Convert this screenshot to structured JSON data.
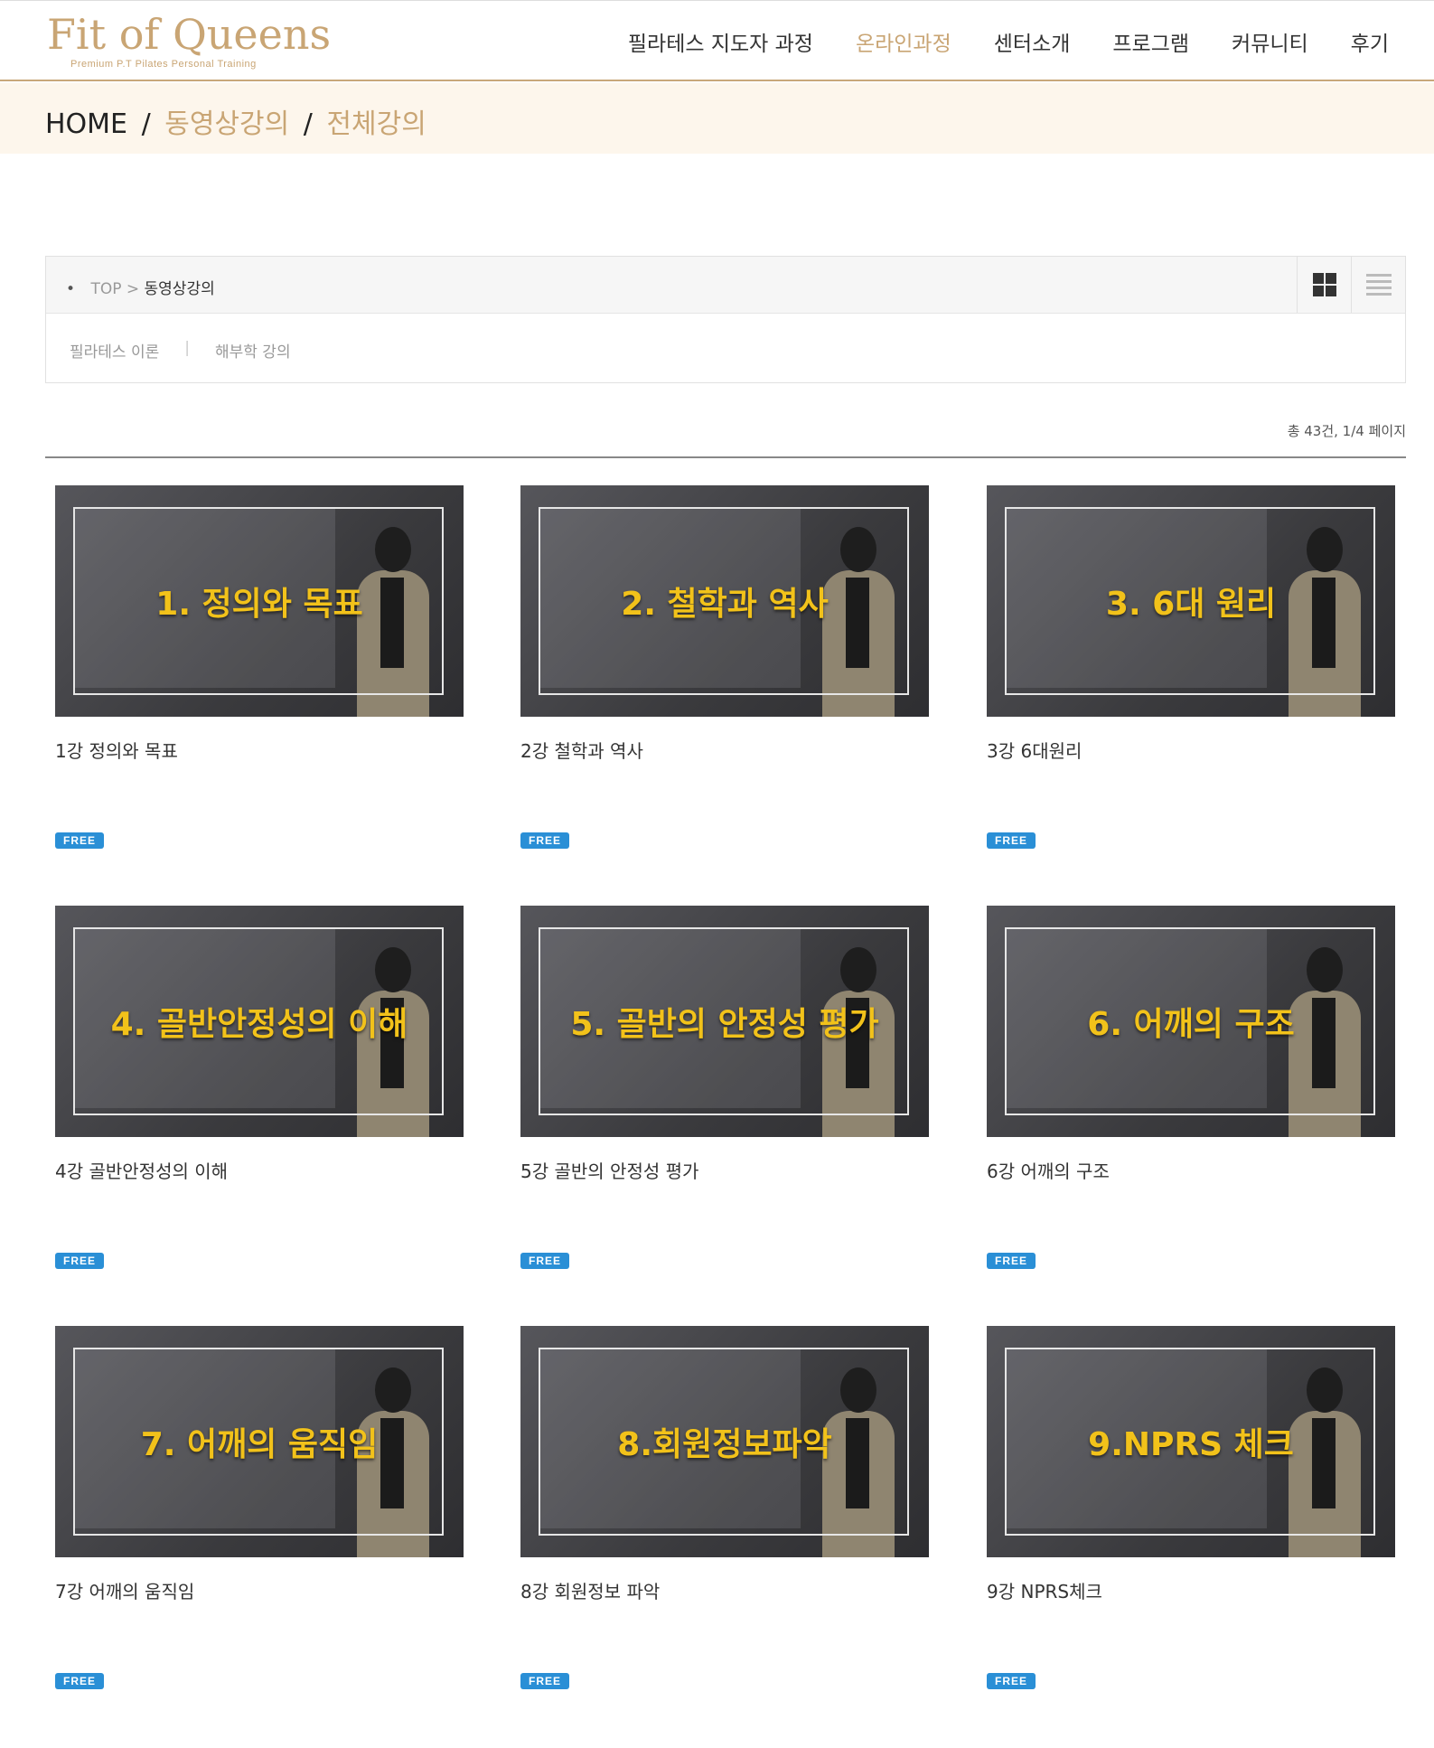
{
  "header": {
    "logo": "Fit of Queens",
    "logo_sub": "Premium P.T Pilates Personal Training",
    "nav": [
      {
        "label": "필라테스 지도자 과정"
      },
      {
        "label": "온라인과정"
      },
      {
        "label": "센터소개"
      },
      {
        "label": "프로그램"
      },
      {
        "label": "커뮤니티"
      },
      {
        "label": "후기"
      }
    ]
  },
  "breadcrumb": {
    "home": "HOME",
    "sep1": "/",
    "section": "동영상강의",
    "sep2": "/",
    "page": "전체강의"
  },
  "category": {
    "path_top": "TOP",
    "path_sep": ">",
    "path_current": "동영상강의",
    "links": [
      "필라테스 이론",
      "해부학 강의"
    ],
    "divider": "|"
  },
  "count_text": "총 43건, 1/4 페이지",
  "cards": [
    {
      "thumb_text": "1. 정의와 목표",
      "title": "1강 정의와 목표",
      "badge": "FREE"
    },
    {
      "thumb_text": "2. 철학과 역사",
      "title": "2강 철학과 역사",
      "badge": "FREE"
    },
    {
      "thumb_text": "3. 6대 원리",
      "title": "3강 6대원리",
      "badge": "FREE"
    },
    {
      "thumb_text": "4. 골반안정성의 이해",
      "title": "4강 골반안정성의 이해",
      "badge": "FREE"
    },
    {
      "thumb_text": "5. 골반의 안정성 평가",
      "title": "5강 골반의 안정성 평가",
      "badge": "FREE"
    },
    {
      "thumb_text": "6. 어깨의 구조",
      "title": "6강 어깨의 구조",
      "badge": "FREE"
    },
    {
      "thumb_text": "7. 어깨의 움직임",
      "title": "7강 어깨의 움직임",
      "badge": "FREE"
    },
    {
      "thumb_text": "8.회원정보파악",
      "title": "8강 회원정보 파악",
      "badge": "FREE"
    },
    {
      "thumb_text": "9.NPRS 체크",
      "title": "9강 NPRS체크",
      "badge": "FREE"
    }
  ],
  "colors": {
    "gold": "#c9a574",
    "badge_blue": "#2a8fd6",
    "thumb_text": "#f2c21a"
  }
}
